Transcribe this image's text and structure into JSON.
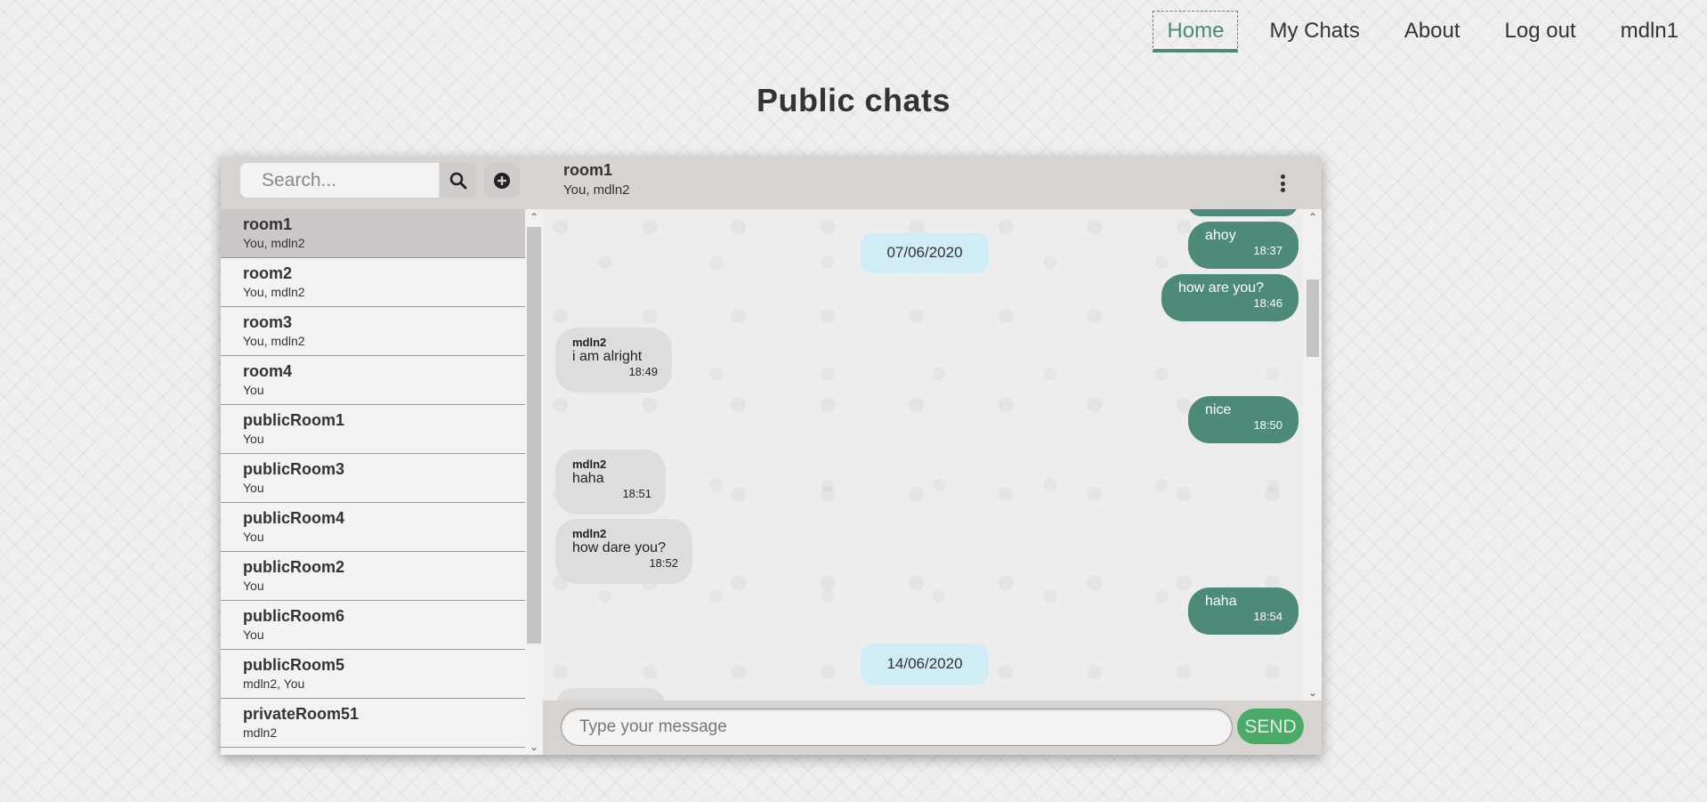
{
  "nav": {
    "items": [
      {
        "label": "Home",
        "active": true
      },
      {
        "label": "My Chats"
      },
      {
        "label": "About"
      },
      {
        "label": "Log out"
      },
      {
        "label": "mdln1"
      }
    ]
  },
  "page": {
    "title": "Public chats"
  },
  "sidebar": {
    "search_placeholder": "Search...",
    "search_icon": "search-icon",
    "add_icon": "plus-circle-icon",
    "rooms": [
      {
        "name": "room1",
        "members": "You, mdln2",
        "selected": true
      },
      {
        "name": "room2",
        "members": "You, mdln2"
      },
      {
        "name": "room3",
        "members": "You, mdln2"
      },
      {
        "name": "room4",
        "members": "You"
      },
      {
        "name": "publicRoom1",
        "members": "You"
      },
      {
        "name": "publicRoom3",
        "members": "You"
      },
      {
        "name": "publicRoom4",
        "members": "You"
      },
      {
        "name": "publicRoom2",
        "members": "You"
      },
      {
        "name": "publicRoom6",
        "members": "You"
      },
      {
        "name": "publicRoom5",
        "members": "mdln2, You"
      },
      {
        "name": "privateRoom51",
        "members": "mdln2"
      }
    ]
  },
  "chat": {
    "room_title": "room1",
    "room_members": "You, mdln2",
    "menu_icon": "kebab-menu-icon",
    "messages": [
      {
        "type": "date",
        "text": "07/06/2020"
      },
      {
        "type": "out",
        "text": "ahoy",
        "time": "18:37"
      },
      {
        "type": "out",
        "text": "how are you?",
        "time": "18:46"
      },
      {
        "type": "in",
        "author": "mdln2",
        "text": "i am alright",
        "time": "18:49"
      },
      {
        "type": "out",
        "text": "nice",
        "time": "18:50"
      },
      {
        "type": "in",
        "author": "mdln2",
        "text": "haha",
        "time": "18:51"
      },
      {
        "type": "in",
        "author": "mdln2",
        "text": "how dare you?",
        "time": "18:52"
      },
      {
        "type": "out",
        "text": "haha",
        "time": "18:54"
      },
      {
        "type": "date",
        "text": "14/06/2020"
      }
    ],
    "input_placeholder": "Type your message",
    "send_label": "SEND"
  },
  "colors": {
    "accent": "#4e8a79",
    "send_button": "#4aab68",
    "date_pill": "#d0ecf5",
    "incoming_bubble": "#dedddd"
  }
}
